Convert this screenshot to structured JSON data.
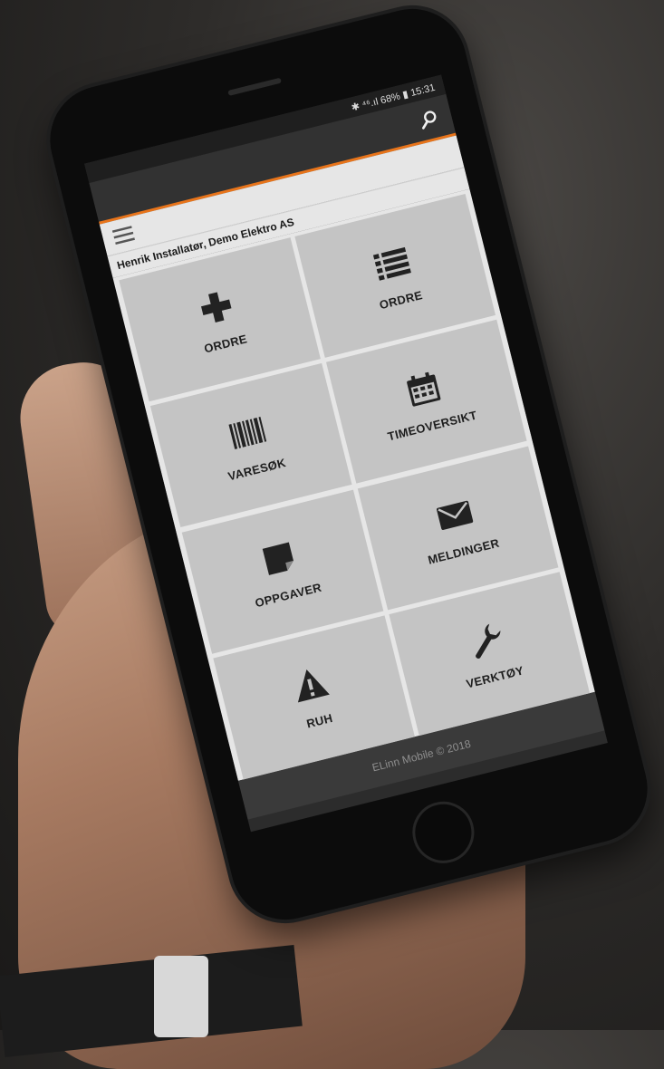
{
  "status_bar": {
    "text": "✱ ⁴⁶.ıl 68% ▮ 15:31"
  },
  "header": {
    "search_icon": "search-icon"
  },
  "nav": {
    "menu_icon": "hamburger-menu-icon"
  },
  "user": {
    "label": "Henrik Installatør, Demo Elektro AS"
  },
  "tiles": [
    {
      "label": "ORDRE",
      "icon": "plus-icon"
    },
    {
      "label": "ORDRE",
      "icon": "list-icon"
    },
    {
      "label": "VARESØK",
      "icon": "barcode-icon"
    },
    {
      "label": "TIMEOVERSIKT",
      "icon": "calendar-icon"
    },
    {
      "label": "OPPGAVER",
      "icon": "sticky-note-icon"
    },
    {
      "label": "MELDINGER",
      "icon": "envelope-icon"
    },
    {
      "label": "RUH",
      "icon": "warning-icon"
    },
    {
      "label": "VERKTØY",
      "icon": "wrench-icon"
    }
  ],
  "footer": {
    "text": "ELinn Mobile © 2018"
  },
  "colors": {
    "accent": "#e8741a",
    "tile": "#c4c4c4",
    "header": "#323232"
  }
}
